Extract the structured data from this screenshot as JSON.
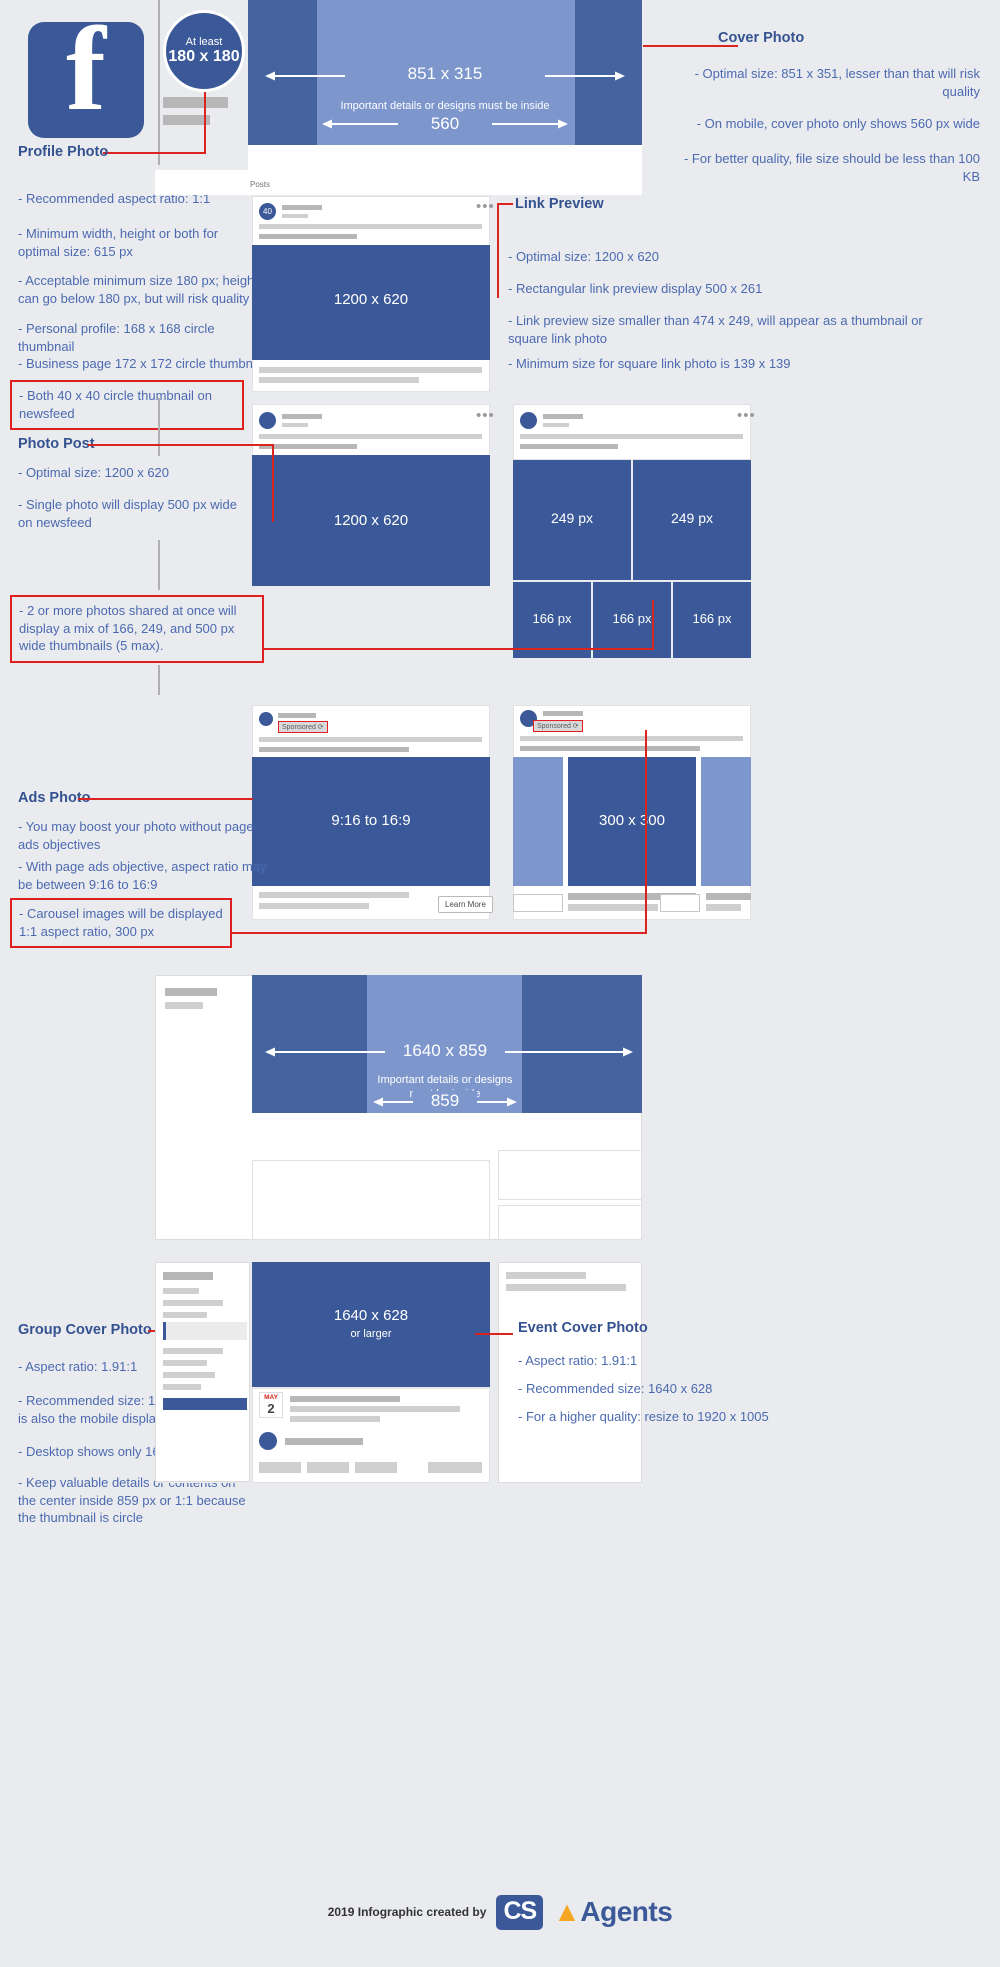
{
  "profile": {
    "badge_line1": "At least",
    "badge_line2": "180 x 180",
    "title": "Profile Photo",
    "bullets": [
      "- Recommended aspect ratio: 1:1",
      "- Minimum width, height or both for optimal size: 615 px",
      "- Acceptable minimum size 180 px; height can go below 180 px, but will risk quality",
      "- Personal profile: 168 x 168 circle thumbnail",
      "- Business page 172 x 172 circle thumbnail"
    ],
    "highlight": "- Both 40 x 40 circle thumbnail on newsfeed"
  },
  "cover": {
    "title": "Cover Photo",
    "dim_label": "851 x 315",
    "inside_note": "Important details or designs must be inside",
    "inside_value": "560",
    "bullets": [
      "- Optimal size: 851 x 351, lesser than that will risk quality",
      "- On mobile, cover photo only shows 560 px wide",
      "- For better quality, file size should be less than 100 KB"
    ]
  },
  "posts_label": "Posts",
  "link_preview": {
    "title": "Link Preview",
    "image_label": "1200 x 620",
    "avatar_label": "40",
    "bullets": [
      "- Optimal size: 1200 x 620",
      "- Rectangular link preview display 500 x 261",
      "- Link preview size smaller than 474 x 249, will appear as a thumbnail or square link photo",
      "- Minimum size for square link photo is 139 x 139"
    ]
  },
  "photo_post": {
    "title": "Photo Post",
    "image_label": "1200 x 620",
    "bullets": [
      "- Optimal size: 1200 x 620",
      "- Single photo will display 500 px wide on newsfeed"
    ],
    "highlight": "- 2 or more photos shared at once will display a mix of 166, 249, and 500 px wide thumbnails (5 max).",
    "multi_labels": [
      "249 px",
      "249 px",
      "166 px",
      "166 px",
      "166 px"
    ]
  },
  "ads": {
    "title": "Ads Photo",
    "sponsored_label": "Sponsored",
    "ratio_label": "9:16 to 16:9",
    "carousel_label": "300 x 300",
    "learn_more": "Learn More",
    "bullets": [
      "- You may boost your photo without page ads objectives",
      "- With page ads objective, aspect ratio may be between 9:16 to 16:9"
    ],
    "highlight": "- Carousel images will be displayed 1:1 aspect ratio, 300 px"
  },
  "group_cover": {
    "title": "Group Cover Photo",
    "dim_label": "1640 x 859",
    "inside_note": "Important details or designs must be inside",
    "inside_value": "859",
    "bullets": [
      "- Aspect ratio: 1.91:1",
      "- Recommended size: 1640 x 859; This is also the mobile display size",
      "- Desktop shows only 1640 x 662",
      "- Keep valuable details or contents on the center inside 859 px or 1:1 because the thumbnail is circle"
    ]
  },
  "event_cover": {
    "title": "Event Cover Photo",
    "image_label_line1": "1640 x 628",
    "image_label_line2": "or larger",
    "date_month": "MAY",
    "date_day": "2",
    "bullets": [
      "- Aspect ratio: 1.91:1",
      "- Recommended size: 1640 x 628",
      "- For a higher quality: resize to 1920 x 1005"
    ]
  },
  "footer": {
    "credit": "2019 Infographic created by",
    "brand_badge": "CS",
    "brand_name": "Agents"
  },
  "colors": {
    "fb_blue": "#3b5998",
    "light_blue": "#7d96cc",
    "accent_red": "#d9241f",
    "background": "#e9ebef"
  }
}
